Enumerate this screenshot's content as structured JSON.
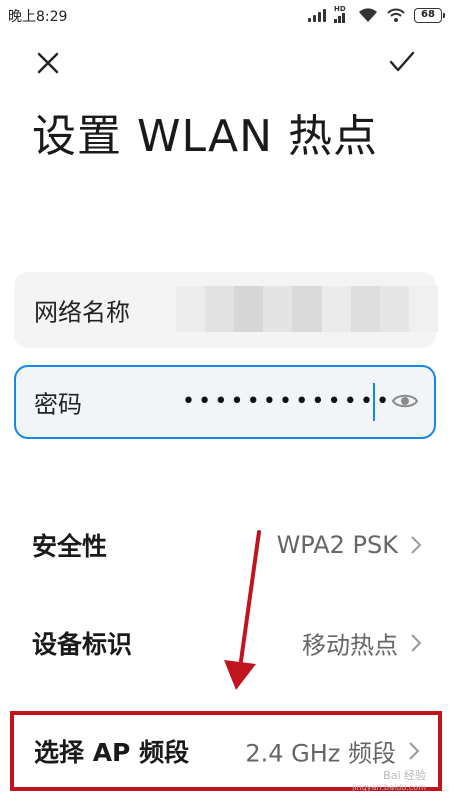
{
  "status_bar": {
    "time": "晚上8:29",
    "network_type": "HD",
    "battery_level": "68"
  },
  "header": {
    "close_icon": "close-icon",
    "confirm_icon": "check-icon",
    "title": "设置 WLAN 热点"
  },
  "fields": {
    "network_name": {
      "label": "网络名称",
      "value": ""
    },
    "password": {
      "label": "密码",
      "masked_value": "•••••••••••••",
      "toggle_icon": "eye-icon"
    }
  },
  "settings": [
    {
      "label": "安全性",
      "value": "WPA2 PSK"
    },
    {
      "label": "设备标识",
      "value": "移动热点"
    },
    {
      "label": "选择 AP 频段",
      "value": "2.4 GHz 频段"
    }
  ],
  "annotation": {
    "highlight_color": "#c0151f"
  },
  "watermark": {
    "text": "Bai 经验",
    "url": "jingyan.baidu.com"
  },
  "colors": {
    "accent": "#1687e6",
    "highlight": "#c0151f"
  }
}
